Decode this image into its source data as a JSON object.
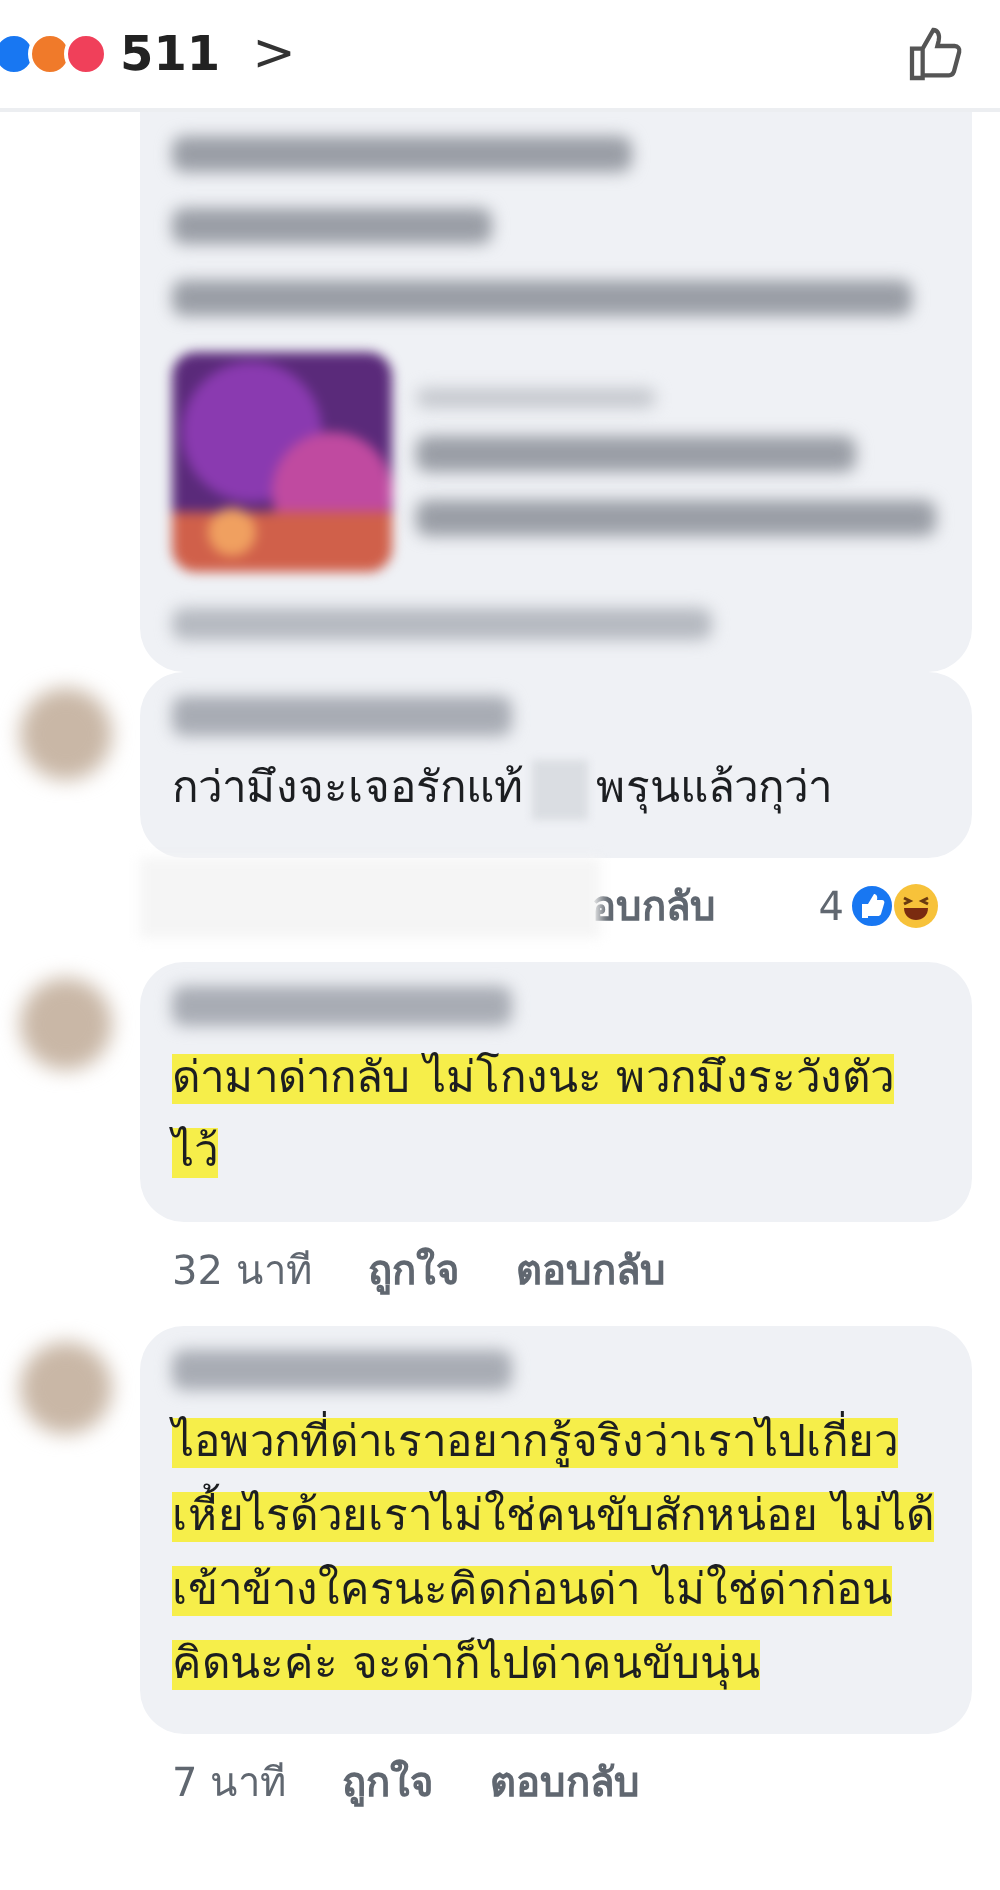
{
  "header": {
    "reaction_count": "511",
    "chevron": ">"
  },
  "comments": [
    {
      "kind": "blurred"
    },
    {
      "kind": "comment",
      "parts": [
        {
          "text": "กว่ามึงจะเจอรักแท้",
          "kind": "text"
        },
        {
          "kind": "redacted"
        },
        {
          "text": "พรุนแล้วกุว่า",
          "kind": "text"
        }
      ],
      "highlighted": false,
      "meta": [
        {
          "text": "อบกลับ",
          "kind": "reply"
        }
      ],
      "meta_redacted": true,
      "reactions": {
        "count": "4"
      }
    },
    {
      "kind": "comment",
      "parts": [
        {
          "text": "ด่ามาด่ากลับ ไม่โกงนะ พวกมึงระวังตัวไว้",
          "kind": "text"
        }
      ],
      "highlighted": true,
      "meta": [
        {
          "text": "32 นาที",
          "kind": "time"
        },
        {
          "text": "ถูกใจ",
          "kind": "like"
        },
        {
          "text": "ตอบกลับ",
          "kind": "reply"
        }
      ],
      "meta_redacted": false
    },
    {
      "kind": "comment",
      "parts": [
        {
          "text": "ไอพวกที่ด่าเราอยากรู้จริงว่าเราไปเกี่ยวเหี้ยไรด้วยเราไม่ใช่คนขับสักหน่อย ไม่ได้เข้าข้างใครนะคิดก่อนด่า ไม่ใช่ด่าก่อนคิดนะค่ะ จะด่าก็ไปด่าคนขับนุ่น",
          "kind": "text"
        }
      ],
      "highlighted": true,
      "meta": [
        {
          "text": "7 นาที",
          "kind": "time"
        },
        {
          "text": "ถูกใจ",
          "kind": "like"
        },
        {
          "text": "ตอบกลับ",
          "kind": "reply"
        }
      ],
      "meta_redacted": false
    }
  ]
}
